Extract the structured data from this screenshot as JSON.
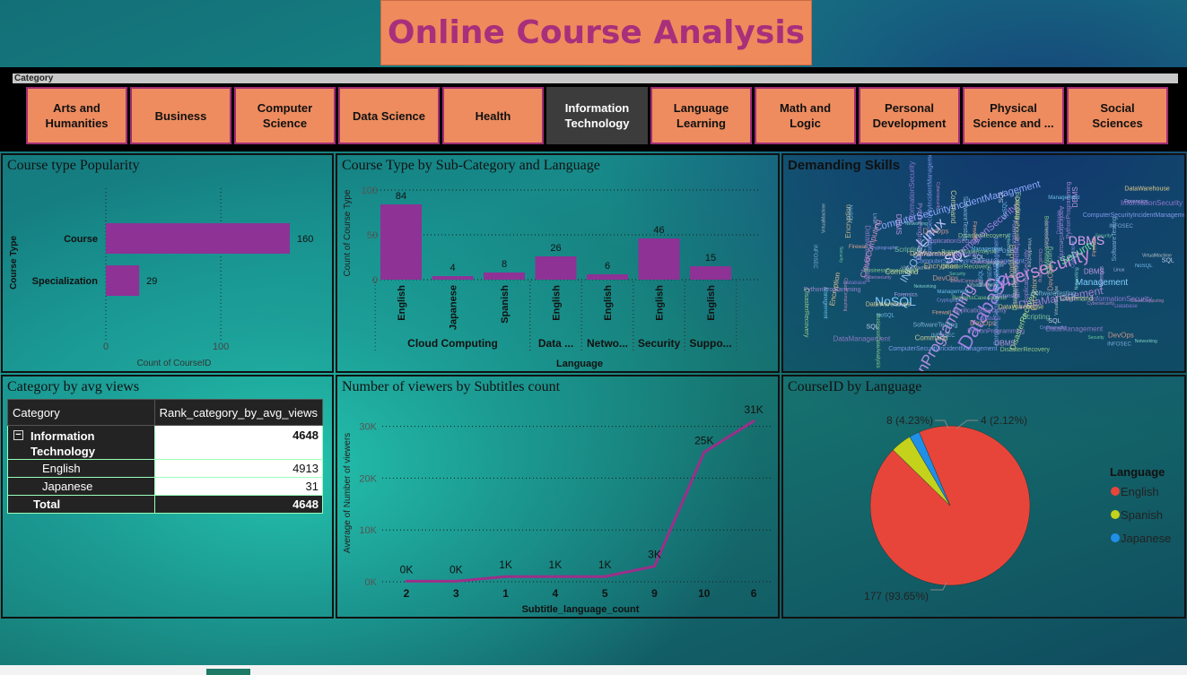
{
  "title": "Online Course Analysis",
  "slicer": {
    "header": "Category",
    "items": [
      {
        "l1": "Arts and",
        "l2": "Humanities"
      },
      {
        "l1": "Business",
        "l2": ""
      },
      {
        "l1": "Computer",
        "l2": "Science"
      },
      {
        "l1": "Data Science",
        "l2": ""
      },
      {
        "l1": "Health",
        "l2": ""
      },
      {
        "l1": "Information",
        "l2": "Technology"
      },
      {
        "l1": "Language",
        "l2": "Learning"
      },
      {
        "l1": "Math and",
        "l2": "Logic"
      },
      {
        "l1": "Personal",
        "l2": "Development"
      },
      {
        "l1": "Physical",
        "l2": "Science and ..."
      },
      {
        "l1": "Social",
        "l2": "Sciences"
      }
    ],
    "selected": "Information Technology"
  },
  "panels": {
    "popularity": "Course type Popularity",
    "subcat": "Course Type by Sub-Category and Language",
    "skills": "Demanding Skills",
    "avgviews": "Category by avg views",
    "viewers": "Number of viewers by Subtitles count",
    "language": "CourseID by Language"
  },
  "table": {
    "headers": [
      "Category",
      "Rank_category_by_avg_views"
    ],
    "parent": {
      "label1": "Information",
      "label2": "Technology",
      "value": "4648"
    },
    "rows": [
      {
        "label": "English",
        "value": "4913"
      },
      {
        "label": "Japanese",
        "value": "31"
      }
    ],
    "total": {
      "label": "Total",
      "value": "4648"
    }
  },
  "wordcloud": [
    {
      "t": "Cybersecurity",
      "c": "#c98bd9"
    },
    {
      "t": "Database",
      "c": "#9b7fe0"
    },
    {
      "t": "PythonProgramming",
      "c": "#b48de0"
    },
    {
      "t": "DBMS",
      "c": "#d9a3f0"
    },
    {
      "t": "Linux",
      "c": "#c4c4ff"
    },
    {
      "t": "NoSQL",
      "c": "#7fc8ff"
    },
    {
      "t": "SQL",
      "c": "#e2e2ff"
    },
    {
      "t": "DataManagement",
      "c": "#a07fd0"
    },
    {
      "t": "Security",
      "c": "#79d9a6"
    },
    {
      "t": "INFOSEC",
      "c": "#8fb8e8"
    },
    {
      "t": "ComputerSecurityIncidentManagement",
      "c": "#8fa8ff"
    },
    {
      "t": "InformationSecurity",
      "c": "#a57fe0"
    },
    {
      "t": "CloudComputing",
      "c": "#d28fc0"
    },
    {
      "t": "Management",
      "c": "#7fd0ff"
    },
    {
      "t": "DisasterRecovery",
      "c": "#b0d98f"
    },
    {
      "t": "Encryption",
      "c": "#e0c08f"
    },
    {
      "t": "VirtualMachine",
      "c": "#d0d0d0"
    },
    {
      "t": "BusinessCaseAnalysis",
      "c": "#9fe08f"
    },
    {
      "t": "ApplicationSecurity",
      "c": "#b48de0"
    },
    {
      "t": "DevOps",
      "c": "#e09f8f"
    },
    {
      "t": "Networking",
      "c": "#8fe0d0"
    },
    {
      "t": "Forensics",
      "c": "#d0b0ff"
    },
    {
      "t": "DataWarehouse",
      "c": "#ffe08f"
    },
    {
      "t": "Scripting",
      "c": "#8fd0a0"
    },
    {
      "t": "Cryptography",
      "c": "#a0a0ff"
    },
    {
      "t": "Firewall",
      "c": "#ffb08f"
    },
    {
      "t": "SoftwareTesting",
      "c": "#8fc0e0"
    },
    {
      "t": "Command",
      "c": "#e0e0a0"
    }
  ],
  "chart_data": [
    {
      "id": "course-type-popularity",
      "type": "bar",
      "orientation": "horizontal",
      "categories": [
        "Course",
        "Specialization"
      ],
      "values": [
        160,
        29
      ],
      "ylabel": "Course Type",
      "xlabel": "Count of CourseID",
      "xlim": [
        0,
        160
      ],
      "xticks": [
        0,
        100
      ],
      "color": "#8e3296"
    },
    {
      "id": "subcategory-language",
      "type": "bar",
      "groups": [
        {
          "name": "Cloud Computing",
          "bars": [
            {
              "lang": "English",
              "value": 84
            },
            {
              "lang": "Japanese",
              "value": 4
            },
            {
              "lang": "Spanish",
              "value": 8
            }
          ]
        },
        {
          "name": "Data ...",
          "bars": [
            {
              "lang": "English",
              "value": 26
            }
          ]
        },
        {
          "name": "Netwo...",
          "bars": [
            {
              "lang": "English",
              "value": 6
            }
          ]
        },
        {
          "name": "Security",
          "bars": [
            {
              "lang": "English",
              "value": 46
            }
          ]
        },
        {
          "name": "Suppo...",
          "bars": [
            {
              "lang": "English",
              "value": 15
            }
          ]
        }
      ],
      "ylabel": "Count of Course Type",
      "xlabel": "Language",
      "ylim": [
        0,
        100
      ],
      "yticks": [
        0,
        50,
        100
      ],
      "color": "#8e3296"
    },
    {
      "id": "viewers-by-subtitles",
      "type": "line",
      "x": [
        "2",
        "3",
        "1",
        "4",
        "5",
        "9",
        "10",
        "6"
      ],
      "y": [
        100,
        100,
        1000,
        1000,
        1000,
        3000,
        25000,
        31000
      ],
      "labels": [
        "0K",
        "0K",
        "1K",
        "1K",
        "1K",
        "3K",
        "25K",
        "31K"
      ],
      "ylabel": "Average of Number of viewers",
      "xlabel": "Subtitle_language_count",
      "ylim": [
        0,
        32000
      ],
      "yticks": [
        {
          "v": 0,
          "t": "0K"
        },
        {
          "v": 10000,
          "t": "10K"
        },
        {
          "v": 20000,
          "t": "20K"
        },
        {
          "v": 30000,
          "t": "30K"
        }
      ],
      "color": "#9c2f8a"
    },
    {
      "id": "courseid-by-language",
      "type": "pie",
      "slices": [
        {
          "name": "English",
          "value": 177,
          "label": "177 (93.65%)",
          "color": "#e8453a"
        },
        {
          "name": "Spanish",
          "value": 8,
          "label": "8 (4.23%)",
          "color": "#c4d21b"
        },
        {
          "name": "Japanese",
          "value": 4,
          "label": "4 (2.12%)",
          "color": "#1f8fe8"
        }
      ],
      "legend_title": "Language",
      "legend_position": "right"
    }
  ]
}
